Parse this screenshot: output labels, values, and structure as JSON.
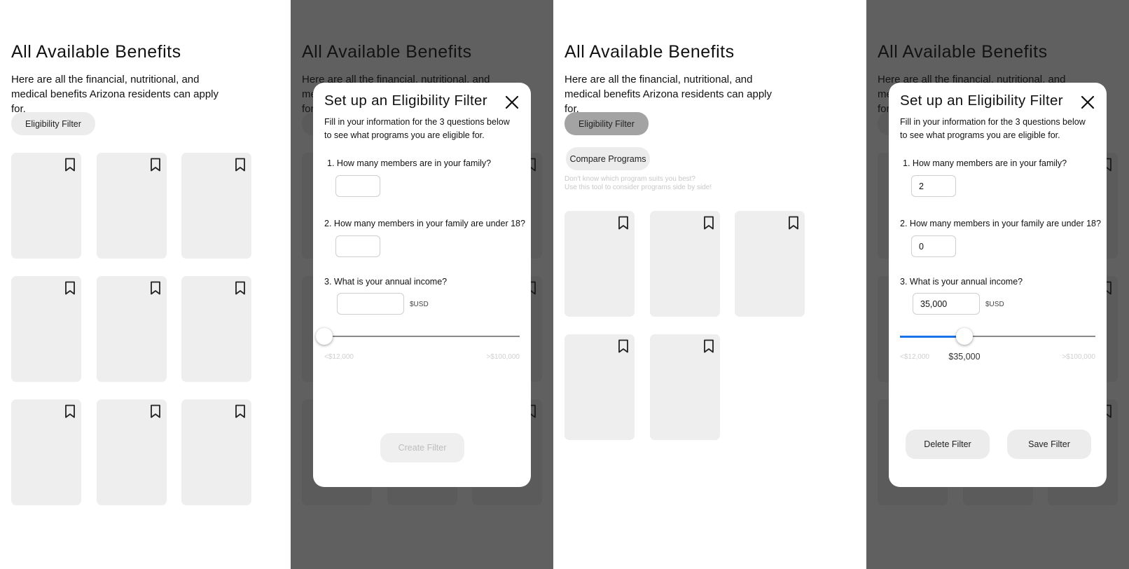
{
  "page": {
    "title": "All Available Benefits",
    "subtitle": "Here are all the financial, nutritional, and medical benefits Arizona residents can apply for."
  },
  "buttons": {
    "eligibility_filter": "Eligibility Filter",
    "compare_programs": "Compare Programs"
  },
  "compare_hint": {
    "line1": "Don't know which program suits you best?",
    "line2": "Use this tool to consider programs side by side!"
  },
  "icons": {
    "bookmark": "bookmark-icon",
    "close": "close-icon"
  },
  "modal": {
    "title": "Set up an Eligibility Filter",
    "description": "Fill in your information for the 3 questions below to see what programs you are eligible for.",
    "q1": "How many members are in your family?",
    "q2": "How many members in your family are under 18?",
    "q3": "What is your annual income?",
    "q1_number": "1.",
    "q2_number": "2.",
    "q3_number": "3.",
    "currency": "$USD",
    "range_min": "<$12,000",
    "range_max": ">$100,000",
    "create_label": "Create Filter",
    "delete_label": "Delete Filter",
    "save_label": "Save Filter"
  },
  "filled_form": {
    "family_members": "2",
    "under_18": "0",
    "income": "35,000",
    "income_slider_value": "$35,000",
    "income_slider_fraction": 0.33
  },
  "empty_form": {
    "income_slider_fraction": 0.0
  },
  "colors": {
    "slider_fill": "#1a73e8",
    "card_bg": "#eeeeee",
    "overlay": "#5e5e5e",
    "active_button": "#a3a3a3"
  }
}
